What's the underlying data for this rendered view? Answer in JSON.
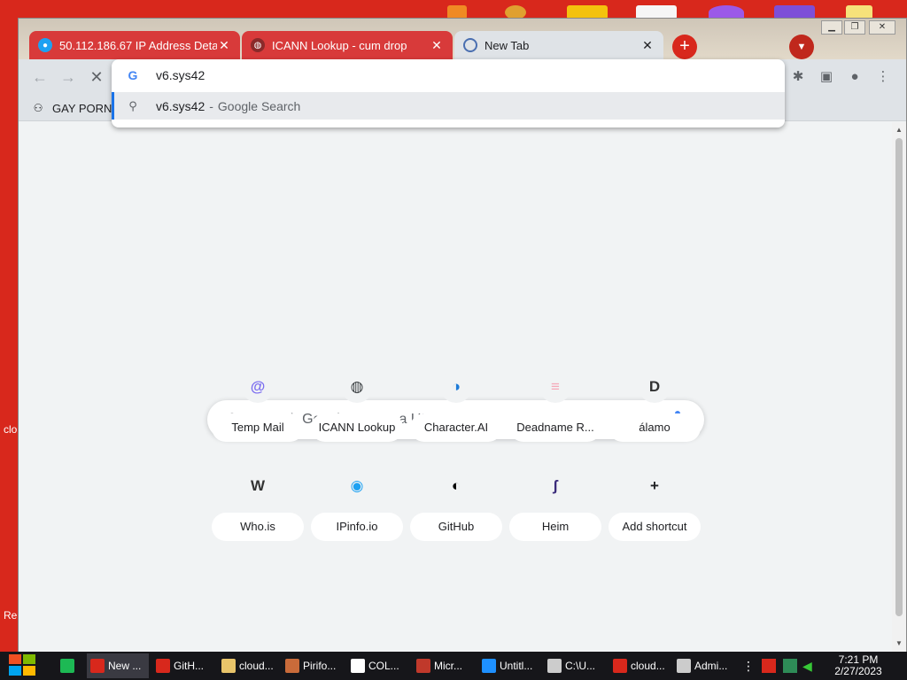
{
  "desktop": {
    "labels": [
      "clo",
      "Re"
    ]
  },
  "window": {
    "controls": [
      "minimize",
      "restore",
      "close"
    ],
    "tabs": [
      {
        "title": "50.112.186.67 IP Address Deta",
        "icon": "location-pin-icon"
      },
      {
        "title": "ICANN Lookup - cum drop",
        "icon": "globe-icon"
      },
      {
        "title": "New Tab",
        "icon": "chrome-newtab-icon"
      }
    ],
    "new_tab_label": "+",
    "tab_search_label": "⌄"
  },
  "bookmarks": {
    "items": [
      {
        "label": "GAY PORN",
        "icon": "bookmark-site-icon"
      }
    ]
  },
  "omnibox": {
    "value": "v6.sys42",
    "suggestion": {
      "query": "v6.sys42",
      "separator": "-",
      "engine": "Google Search"
    }
  },
  "page": {
    "search_placeholder": "Search Google or type a URL",
    "shortcuts": [
      {
        "label": "Temp Mail",
        "glyph": "@",
        "color": "#7a6cf0"
      },
      {
        "label": "ICANN Lookup",
        "glyph": "◍",
        "color": "#3c4043"
      },
      {
        "label": "Character.AI",
        "glyph": "◑",
        "color": "#1e7bd8"
      },
      {
        "label": "Deadname R...",
        "glyph": "≡",
        "color": "#f5a9b8"
      },
      {
        "label": "álamo",
        "glyph": "D",
        "color": "#333333"
      },
      {
        "label": "Who.is",
        "glyph": "W",
        "color": "#333333"
      },
      {
        "label": "IPinfo.io",
        "glyph": "◉",
        "color": "#1da1f2"
      },
      {
        "label": "GitHub",
        "glyph": "◐",
        "color": "#000000"
      },
      {
        "label": "Heim",
        "glyph": "ʃ",
        "color": "#3a2a7a"
      },
      {
        "label": "Add shortcut",
        "glyph": "+",
        "color": "#202124"
      }
    ]
  },
  "taskbar": {
    "items": [
      {
        "label": "",
        "icon": "spotify-icon",
        "color": "#1db954"
      },
      {
        "label": "New ...",
        "icon": "chrome-icon",
        "color": "#d8281c"
      },
      {
        "label": "GitH...",
        "icon": "chrome-icon",
        "color": "#d8281c"
      },
      {
        "label": "cloud...",
        "icon": "folder-icon",
        "color": "#e8c46a"
      },
      {
        "label": "Pirifo...",
        "icon": "app-icon",
        "color": "#c96b3a"
      },
      {
        "label": "COL...",
        "icon": "app-icon",
        "color": "#ffffff"
      },
      {
        "label": "Micr...",
        "icon": "app-icon",
        "color": "#c0392b"
      },
      {
        "label": "Untitl...",
        "icon": "app-icon",
        "color": "#1e90ff"
      },
      {
        "label": "C:\\U...",
        "icon": "console-icon",
        "color": "#cccccc"
      },
      {
        "label": "cloud...",
        "icon": "app-icon",
        "color": "#d8281c"
      },
      {
        "label": "Admi...",
        "icon": "console-icon",
        "color": "#cccccc"
      }
    ],
    "clock": {
      "time": "7:21 PM",
      "date": "2/27/2023"
    }
  }
}
